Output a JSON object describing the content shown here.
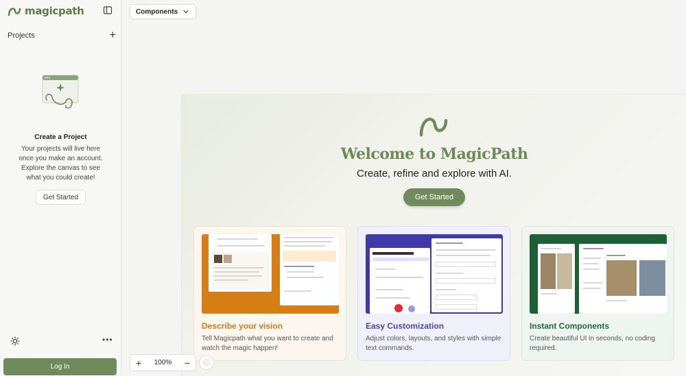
{
  "app": {
    "brand": "magicpath"
  },
  "sidebar": {
    "projects_label": "Projects",
    "empty_title": "Create a Project",
    "empty_desc": "Your projects will live here once you make an account. Explore the canvas to see what you could create!",
    "get_started_label": "Get Started",
    "login_label": "Log In"
  },
  "toolbar": {
    "components_label": "Components"
  },
  "welcome": {
    "title": "Welcome to MagicPath",
    "subtitle": "Create, refine and explore with AI.",
    "cta_label": "Get Started",
    "cards": [
      {
        "title": "Describe your vision",
        "desc": "Tell Magicpath what you want to create and watch the magic happen!"
      },
      {
        "title": "Easy Customization",
        "desc": "Adjust colors, layouts, and styles with simple text commands."
      },
      {
        "title": "Instant Components",
        "desc": "Create beautiful UI in seconds, no coding required."
      }
    ]
  },
  "zoom": {
    "value": "100%",
    "plus": "+",
    "minus": "−"
  },
  "colors": {
    "brand_green": "#6f8a5b",
    "vision_orange": "#d37a1b",
    "custom_indigo": "#4b45b8",
    "instant_green": "#1e6a3a"
  }
}
